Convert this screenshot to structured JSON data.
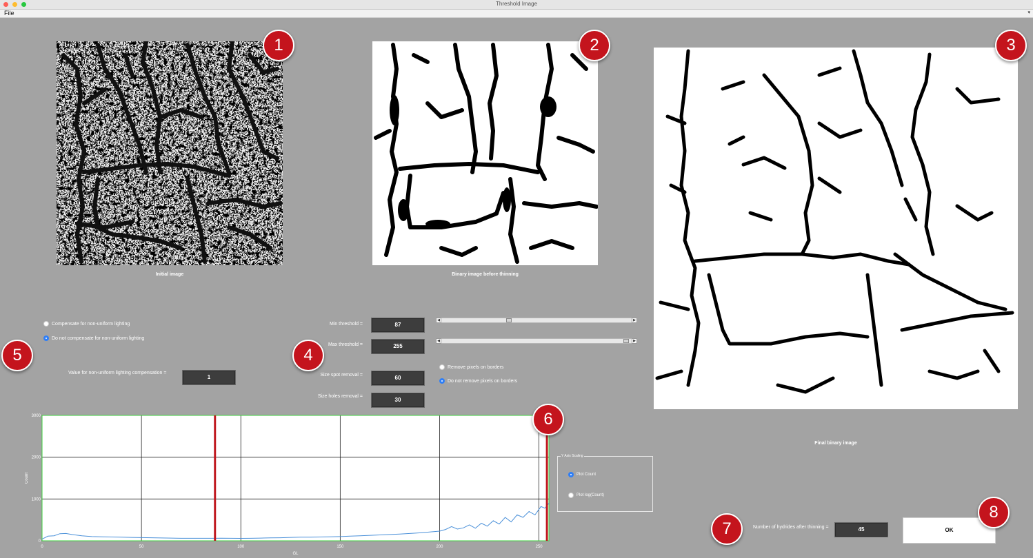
{
  "window": {
    "title": "Threshold Image"
  },
  "menu": {
    "file": "File"
  },
  "panels": {
    "initial": {
      "caption": "Initial image"
    },
    "binary": {
      "caption": "Binary image before thinning"
    },
    "final": {
      "caption": "Final binary image"
    }
  },
  "lighting": {
    "option_compensate": "Compensate for non-uniform lighting",
    "option_no_compensate": "Do not compensate for non-uniform lighting",
    "selected": "no_compensate",
    "value_label": "Value for non-uniform lighting compensation =",
    "value": "1"
  },
  "threshold": {
    "min_label": "Min threshold =",
    "min_value": "87",
    "max_label": "Max threshold =",
    "max_value": "255",
    "slider_range": [
      0,
      255
    ],
    "spot_label": "Size spot removal =",
    "spot_value": "60",
    "holes_label": "Size holes removal =",
    "holes_value": "30"
  },
  "borders": {
    "option_remove": "Remove pixels on borders",
    "option_keep": "Do not remove pixels on borders",
    "selected": "keep"
  },
  "histogram": {
    "ylabel": "Count",
    "xlabel": "GL",
    "xticks": [
      "0",
      "50",
      "100",
      "150",
      "200",
      "250"
    ],
    "yticks": [
      "0",
      "1000",
      "2000",
      "3000"
    ],
    "chart_data": {
      "type": "line",
      "xlim": [
        0,
        255
      ],
      "ylim": [
        0,
        3000
      ],
      "grid": true,
      "threshold_lines": [
        87,
        254
      ],
      "x": [
        0,
        3,
        6,
        9,
        12,
        15,
        20,
        25,
        30,
        35,
        40,
        45,
        50,
        55,
        60,
        65,
        70,
        75,
        80,
        87,
        90,
        95,
        100,
        105,
        110,
        115,
        120,
        125,
        130,
        135,
        140,
        145,
        150,
        155,
        160,
        165,
        170,
        175,
        180,
        185,
        190,
        195,
        200,
        203,
        206,
        209,
        212,
        215,
        218,
        221,
        224,
        227,
        230,
        233,
        236,
        239,
        242,
        245,
        248,
        251,
        253,
        255
      ],
      "y": [
        40,
        110,
        120,
        170,
        175,
        150,
        120,
        100,
        95,
        90,
        85,
        80,
        75,
        72,
        68,
        65,
        60,
        60,
        60,
        60,
        62,
        60,
        58,
        60,
        65,
        70,
        72,
        80,
        85,
        85,
        90,
        95,
        100,
        110,
        120,
        130,
        140,
        150,
        160,
        175,
        190,
        210,
        230,
        270,
        340,
        280,
        310,
        380,
        300,
        420,
        350,
        480,
        400,
        560,
        450,
        620,
        560,
        700,
        620,
        820,
        780,
        900
      ]
    }
  },
  "yscale": {
    "title": "Y Axis Scaling",
    "option_count": "Plot Count",
    "option_log": "Plot log(Count)",
    "selected": "count"
  },
  "hydrides": {
    "label": "Number of hydrides after thinning =",
    "value": "45"
  },
  "ok": {
    "label": "OK"
  },
  "badges": [
    "1",
    "2",
    "3",
    "4",
    "5",
    "6",
    "7",
    "8"
  ],
  "colors": {
    "badge": "#c4141d",
    "accent": "#2f7ff7",
    "threshold_line": "#c0181f",
    "hist_line": "#4a90d9",
    "plot_frame": "#3cd03c"
  }
}
